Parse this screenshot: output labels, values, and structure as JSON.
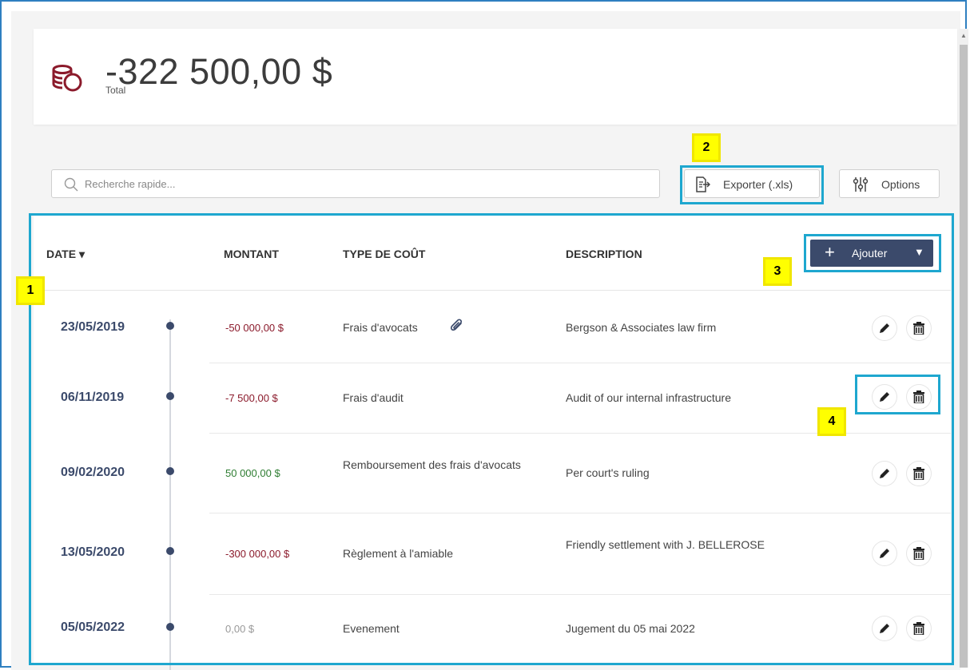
{
  "header": {
    "total_amount": "-322 500,00 $",
    "total_label": "Total",
    "icon": "coins-icon",
    "icon_color": "#8b1a2b"
  },
  "toolbar": {
    "search_placeholder": "Recherche rapide...",
    "export_label": "Exporter (.xls)",
    "options_label": "Options"
  },
  "table": {
    "columns": {
      "date": "DATE",
      "amount": "MONTANT",
      "cost_type": "TYPE DE COÛT",
      "description": "DESCRIPTION"
    },
    "sort_indicator": "▾",
    "add_button": {
      "label": "Ajouter",
      "plus": "+",
      "caret": "▼"
    },
    "rows": [
      {
        "date": "23/05/2019",
        "amount": "-50 000,00 $",
        "amount_sign": "negative",
        "type": "Frais d'avocats",
        "has_attachment": true,
        "description": "Bergson & Associates law firm"
      },
      {
        "date": "06/11/2019",
        "amount": "-7 500,00 $",
        "amount_sign": "negative",
        "type": "Frais d'audit",
        "has_attachment": false,
        "description": "Audit of our internal infrastructure"
      },
      {
        "date": "09/02/2020",
        "amount": "50 000,00 $",
        "amount_sign": "positive",
        "type": "Remboursement des frais d'avocats",
        "has_attachment": false,
        "description": "Per court's ruling"
      },
      {
        "date": "13/05/2020",
        "amount": "-300 000,00 $",
        "amount_sign": "negative",
        "type": "Règlement à l'amiable",
        "has_attachment": false,
        "description": "Friendly settlement with J. BELLEROSE"
      },
      {
        "date": "05/05/2022",
        "amount": "0,00 $",
        "amount_sign": "zero",
        "type": "Evenement",
        "has_attachment": false,
        "description": "Jugement du 05 mai 2022"
      }
    ]
  },
  "annotations": [
    "1",
    "2",
    "3",
    "4"
  ],
  "colors": {
    "accent": "#3b4a6b",
    "negative": "#8b1a2b",
    "positive": "#2e7d32",
    "zero": "#999999",
    "annotation_box": "#1ea7cf",
    "annotation_tag": "#ffff00"
  }
}
